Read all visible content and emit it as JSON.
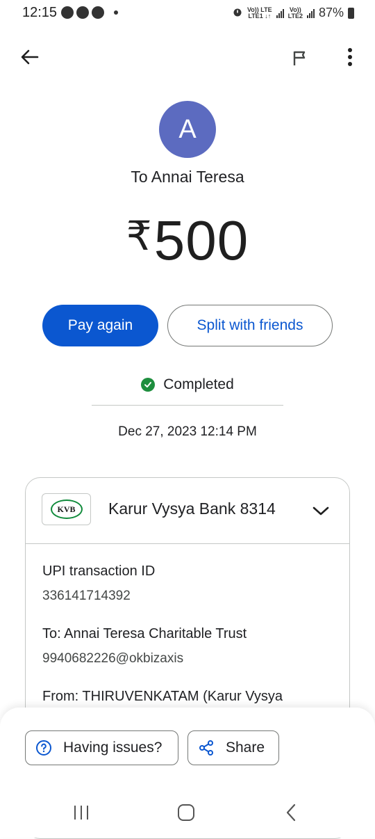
{
  "status_bar": {
    "time": "12:15",
    "sim1_top": "Vo)) LTE",
    "sim1_bottom": "LTE1 ↓↑",
    "sim2_top": "Vo))",
    "sim2_bottom": "LTE2",
    "battery": "87%"
  },
  "app_bar": {
    "back_icon": "arrow-back-icon",
    "report_icon": "flag-icon",
    "more_icon": "more-vert-icon"
  },
  "payee": {
    "avatar_letter": "A",
    "avatar_color": "#5c6bc0",
    "title": "To Annai Teresa"
  },
  "amount": {
    "currency": "₹",
    "value": "500"
  },
  "actions": {
    "pay_again": "Pay again",
    "split": "Split with friends"
  },
  "status": {
    "text": "Completed",
    "color": "#1e8e3e",
    "datetime": "Dec 27, 2023 12:14 PM"
  },
  "details": {
    "bank_logo_text": "KVB",
    "bank_name": "Karur Vysya Bank 8314",
    "upi_label": "UPI transaction ID",
    "upi_value": "336141714392",
    "to_label": "To: Annai Teresa Charitable Trust",
    "to_value": "9940682226@okbizaxis",
    "from_label": "From: THIRUVENKATAM (Karur Vysya"
  },
  "bottom": {
    "issues": "Having issues?",
    "share": "Share"
  },
  "colors": {
    "primary": "#0b57d0",
    "outline": "#747775"
  }
}
